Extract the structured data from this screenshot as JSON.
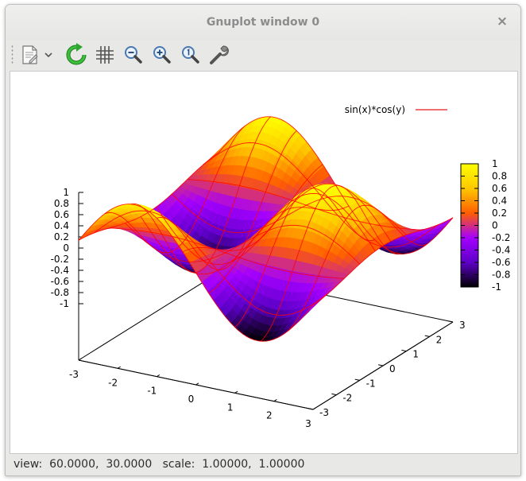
{
  "window": {
    "title": "Gnuplot window 0",
    "close_symbol": "×"
  },
  "toolbar": {
    "buttons": [
      {
        "name": "export-icon"
      },
      {
        "name": "chevron-down-icon"
      },
      {
        "name": "replot-icon"
      },
      {
        "name": "grid-icon"
      },
      {
        "name": "zoom-out-icon"
      },
      {
        "name": "zoom-in-icon"
      },
      {
        "name": "zoom-reset-icon"
      },
      {
        "name": "settings-wrench-icon"
      }
    ]
  },
  "status": {
    "text": "view:  60.0000,  30.0000   scale:  1.00000,  1.00000"
  },
  "chart_data": {
    "type": "surface",
    "function": "sin(x)*cos(y)",
    "legend": [
      {
        "name": "sin(x)*cos(y)",
        "color": "#e41a1c"
      }
    ],
    "legend_position": "top-right",
    "view": {
      "rot_x": 60,
      "rot_z": 30
    },
    "xrange": [
      -3,
      3
    ],
    "yrange": [
      -3,
      3
    ],
    "zrange": [
      -1,
      1
    ],
    "x_ticks": [
      "-3",
      "-2",
      "-1",
      "0",
      "1",
      "2",
      "3"
    ],
    "y_ticks": [
      "-3",
      "-2",
      "-1",
      "0",
      "1",
      "2",
      "3"
    ],
    "z_ticks": [
      "1",
      "0.8",
      "0.6",
      "0.4",
      "0.2",
      "0",
      "-0.2",
      "-0.4",
      "-0.6",
      "-0.8",
      "-1"
    ],
    "colorbox_ticks": [
      "1",
      "0.8",
      "0.6",
      "0.4",
      "0.2",
      "0",
      "-0.2",
      "-0.4",
      "-0.6",
      "-0.8",
      "-1"
    ],
    "palette": [
      "#000000",
      "#5d00c8",
      "#a500ff",
      "#ff5d00",
      "#ffc800",
      "#ffff00"
    ],
    "mesh_color": "#ff0000",
    "samples": 10,
    "isosamples": 10
  }
}
